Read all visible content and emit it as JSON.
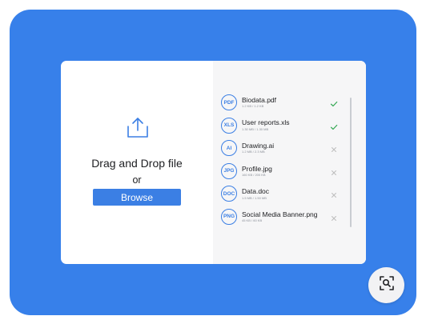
{
  "colors": {
    "frame_background": "#3780EA",
    "accent": "#3B7FE4",
    "success": "#34A853",
    "muted": "#BDBDBD"
  },
  "dropzone": {
    "icon": "upload-icon",
    "title": "Drag and Drop file",
    "or_text": "or",
    "browse_label": "Browse"
  },
  "files": [
    {
      "ext": "PDF",
      "name": "Biodata.pdf",
      "size": "1.2 KB / 1.2 KB",
      "status": "complete"
    },
    {
      "ext": "XLS",
      "name": "User reports.xls",
      "size": "1.30 MB / 1.30 MB",
      "status": "complete"
    },
    {
      "ext": "AI",
      "name": "Drawing.ai",
      "size": "1.2 MB / 2.3 MB",
      "status": "uploading"
    },
    {
      "ext": "JPG",
      "name": "Profile.jpg",
      "size": "160 KB / 200 KB",
      "status": "uploading"
    },
    {
      "ext": "DOC",
      "name": "Data.doc",
      "size": "1.5 MB / 1.50 MB",
      "status": "uploading"
    },
    {
      "ext": "PNG",
      "name": "Social Media Banner.png",
      "size": "45 KB / 60 KB",
      "status": "uploading"
    }
  ],
  "zoom_button": {
    "icon": "zoom-search-icon"
  }
}
